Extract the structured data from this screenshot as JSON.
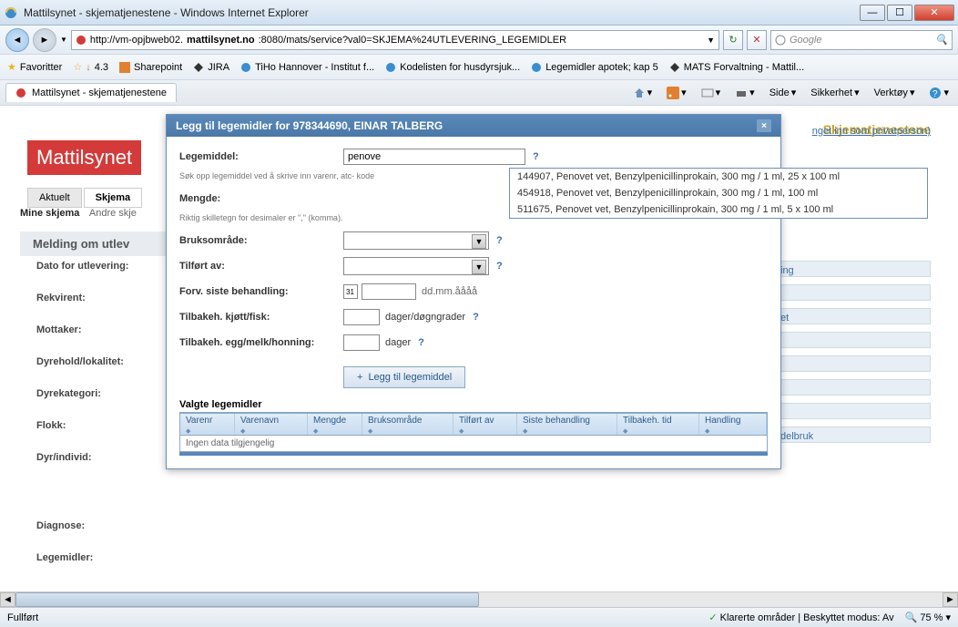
{
  "window": {
    "title": "Mattilsynet - skjematjenestene - Windows Internet Explorer"
  },
  "nav": {
    "url_pre": "http://vm-opjbweb02.",
    "url_host": "mattilsynet.no",
    "url_post": ":8080/mats/service?val0=SKJEMA%24UTLEVERING_LEGEMIDLER",
    "search_placeholder": "Google"
  },
  "favorites": {
    "label": "Favoritter",
    "items": [
      "4.3",
      "Sharepoint",
      "JIRA",
      "TiHo Hannover - Institut f...",
      "Kodelisten for husdyrsjuk...",
      "Legemidler apotek; kap 5",
      "MATS Forvaltning - Mattil..."
    ]
  },
  "tab": {
    "label": "Mattilsynet - skjematjenestene"
  },
  "cmdbar": {
    "side": "Side",
    "sikkerhet": "Sikkerhet",
    "verktoy": "Verktøy"
  },
  "page": {
    "brand": "Mattilsynet",
    "toplinks": "Skjematjenestene",
    "privat": "nget inn som privatperson)",
    "tabs": [
      "Aktuelt",
      "Skjema"
    ],
    "subtabs": {
      "mine": "Mine skjema",
      "andre": "Andre skje"
    },
    "section": "Melding om utlev",
    "labels": [
      "Dato for utlevering:",
      "Rekvirent:",
      "Mottaker:",
      "Dyrehold/lokalitet:",
      "Dyrekategori:",
      "Flokk:",
      "Dyr/individ:",
      "Diagnose:",
      "Legemidler:"
    ],
    "right_partial": [
      "ing",
      "",
      "et",
      "",
      "",
      "",
      "",
      "delbruk"
    ]
  },
  "modal": {
    "title": "Legg til legemidler for 978344690, EINAR TALBERG",
    "fields": {
      "legemiddel": "Legemiddel:",
      "legemiddel_value": "penove",
      "legemiddel_hint": "Søk opp legemiddel ved å skrive inn varenr, atc- kode",
      "mengde": "Mengde:",
      "mengde_hint": "Riktig skilletegn for desimaler er \",\" (komma).",
      "bruksomrade": "Bruksområde:",
      "tilfort": "Tilført av:",
      "forv": "Forv. siste behandling:",
      "forv_hint": "dd.mm.åååå",
      "tilbakeh_kjott": "Tilbakeh. kjøtt/fisk:",
      "tilbakeh_kjott_unit": "dager/døgngrader",
      "tilbakeh_egg": "Tilbakeh. egg/melk/honning:",
      "tilbakeh_egg_unit": "dager"
    },
    "dropdown": [
      "144907, Penovet vet, Benzylpenicillinprokain, 300 mg / 1 ml, 25 x 100 ml",
      "454918, Penovet vet, Benzylpenicillinprokain, 300 mg / 1 ml, 100 ml",
      "511675, Penovet vet, Benzylpenicillinprokain, 300 mg / 1 ml, 5 x 100 ml"
    ],
    "add_button": "Legg til legemiddel",
    "grid_title": "Valgte legemidler",
    "grid_cols": [
      "Varenr",
      "Varenavn",
      "Mengde",
      "Bruksområde",
      "Tilført av",
      "Siste behandling",
      "Tilbakeh. tid",
      "Handling"
    ],
    "grid_empty": "Ingen data tilgjengelig"
  },
  "status": {
    "left": "Fullført",
    "protected": "Klarerte områder | Beskyttet modus: Av",
    "zoom": "75 %"
  }
}
